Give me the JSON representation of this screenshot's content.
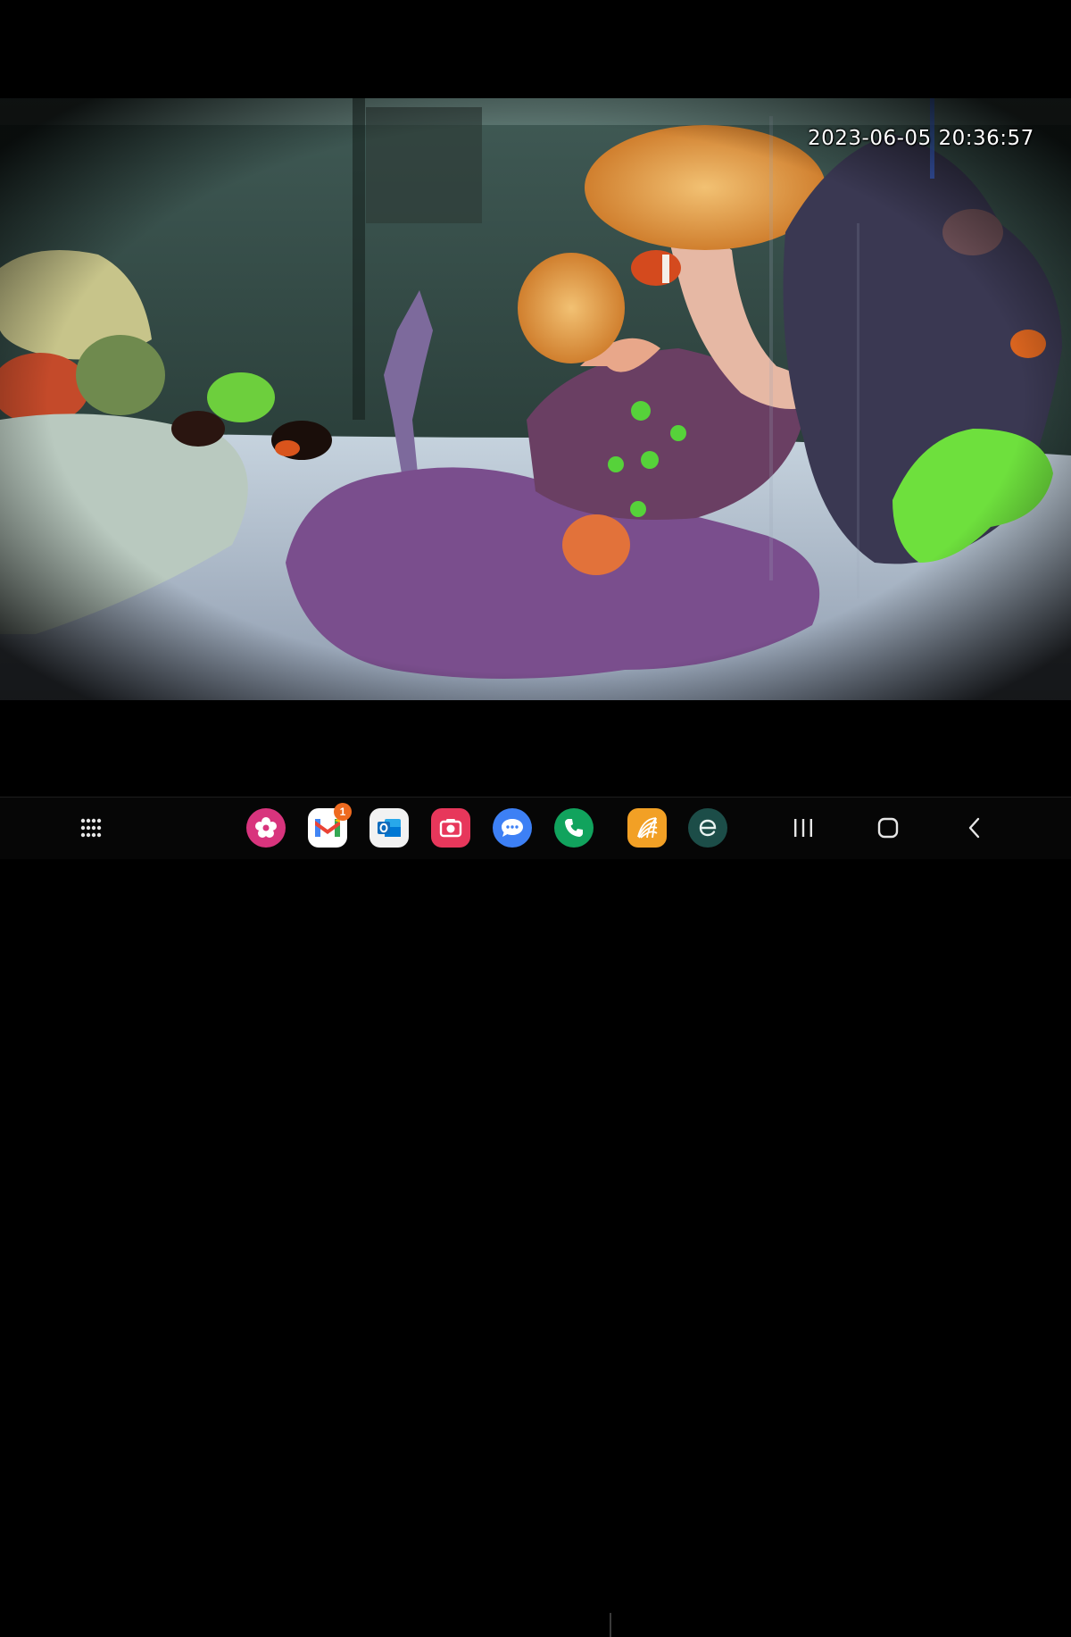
{
  "camera": {
    "timestamp": "2023-06-05 20:36:57",
    "scene": "reef-aquarium"
  },
  "taskbar": {
    "apps": [
      {
        "name": "blossom-app",
        "icon": "flower-icon",
        "color": "#d8347d"
      },
      {
        "name": "gmail",
        "icon": "gmail-icon",
        "color": "#ffffff",
        "badge": "1"
      },
      {
        "name": "outlook",
        "icon": "outlook-icon",
        "color": "#0f6cbd"
      },
      {
        "name": "screen-recorder",
        "icon": "camera-icon",
        "color": "#e7375b"
      },
      {
        "name": "messages",
        "icon": "chat-bubble-icon",
        "color": "#3d80f5"
      },
      {
        "name": "phone",
        "icon": "phone-icon",
        "color": "#11a35d"
      },
      {
        "name": "recent-app-1",
        "icon": "stripes-icon",
        "color": "#f2a025"
      },
      {
        "name": "recent-app-2",
        "icon": "e-letter-icon",
        "color": "#1c4d48"
      }
    ],
    "navigation": [
      "recents-icon",
      "home-icon",
      "back-icon"
    ]
  }
}
